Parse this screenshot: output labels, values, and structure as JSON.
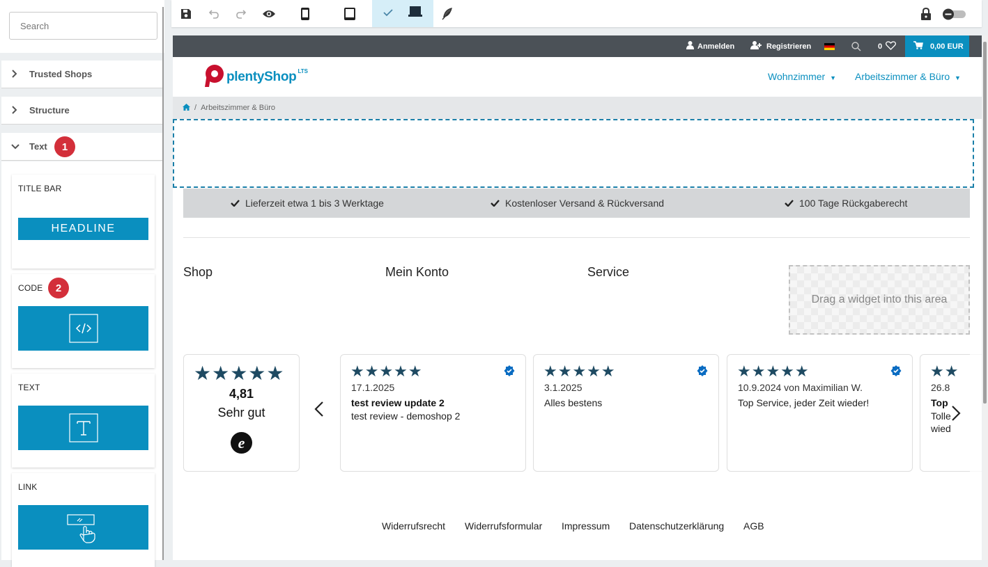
{
  "sidebar": {
    "search_placeholder": "Search",
    "sections": [
      {
        "label": "Trusted Shops"
      },
      {
        "label": "Structure"
      },
      {
        "label": "Text"
      }
    ],
    "badges": [
      "1",
      "2"
    ],
    "widgets": [
      {
        "label": "TITLE BAR",
        "preview_text": "HEADLINE",
        "icon": "headline-icon"
      },
      {
        "label": "CODE",
        "icon": "code-icon"
      },
      {
        "label": "TEXT",
        "icon": "text-icon"
      },
      {
        "label": "LINK",
        "icon": "link-hand-icon"
      }
    ]
  },
  "toolbar": {
    "buttons": [
      "save-icon",
      "undo-icon",
      "redo-icon",
      "eye-icon",
      "phone-icon",
      "tablet-icon",
      "desktop-icon",
      "feather-icon",
      "lock-icon",
      "toggle-switch"
    ],
    "active_device": "desktop"
  },
  "shop": {
    "topbar": {
      "login": "Anmelden",
      "register": "Registrieren",
      "wishlist_count": "0",
      "cart_total": "0,00 EUR"
    },
    "logo": {
      "brand": "plentyShop",
      "suffix": "LTS"
    },
    "nav": [
      "Wohnzimmer",
      "Arbeitszimmer & Büro"
    ],
    "breadcrumb": {
      "separator": "/",
      "current": "Arbeitszimmer & Büro"
    },
    "usps": [
      "Lieferzeit etwa 1 bis 3 Werktage",
      "Kostenloser Versand & Rückversand",
      "100 Tage Rückgaberecht"
    ],
    "footer_columns": [
      "Shop",
      "Mein Konto",
      "Service"
    ],
    "drag_area_text": "Drag a widget into this area",
    "rating": {
      "score": "4,81",
      "label": "Sehr gut",
      "stars": "★★★★★",
      "seal": "e"
    },
    "reviews": [
      {
        "stars": "★★★★★",
        "date": "17.1.2025",
        "title": "test review update 2",
        "text": "test review - demoshop 2"
      },
      {
        "stars": "★★★★★",
        "date": "3.1.2025",
        "title": "",
        "text": "Alles bestens"
      },
      {
        "stars": "★★★★★",
        "date": "10.9.2024 von Maximilian W.",
        "title": "",
        "text": "Top Service, jeder Zeit wieder!"
      },
      {
        "stars": "★★",
        "date": "26.8",
        "title": "Top",
        "text": "Tolle",
        "text2": "wied"
      }
    ],
    "footer_links": [
      "Widerrufsrecht",
      "Widerrufsformular",
      "Impressum",
      "Datenschutzerklärung",
      "AGB"
    ]
  },
  "colors": {
    "accent": "#0a8fbf",
    "badge": "#d32f3a",
    "topbar": "#4b5157",
    "star": "#1e4a62"
  }
}
